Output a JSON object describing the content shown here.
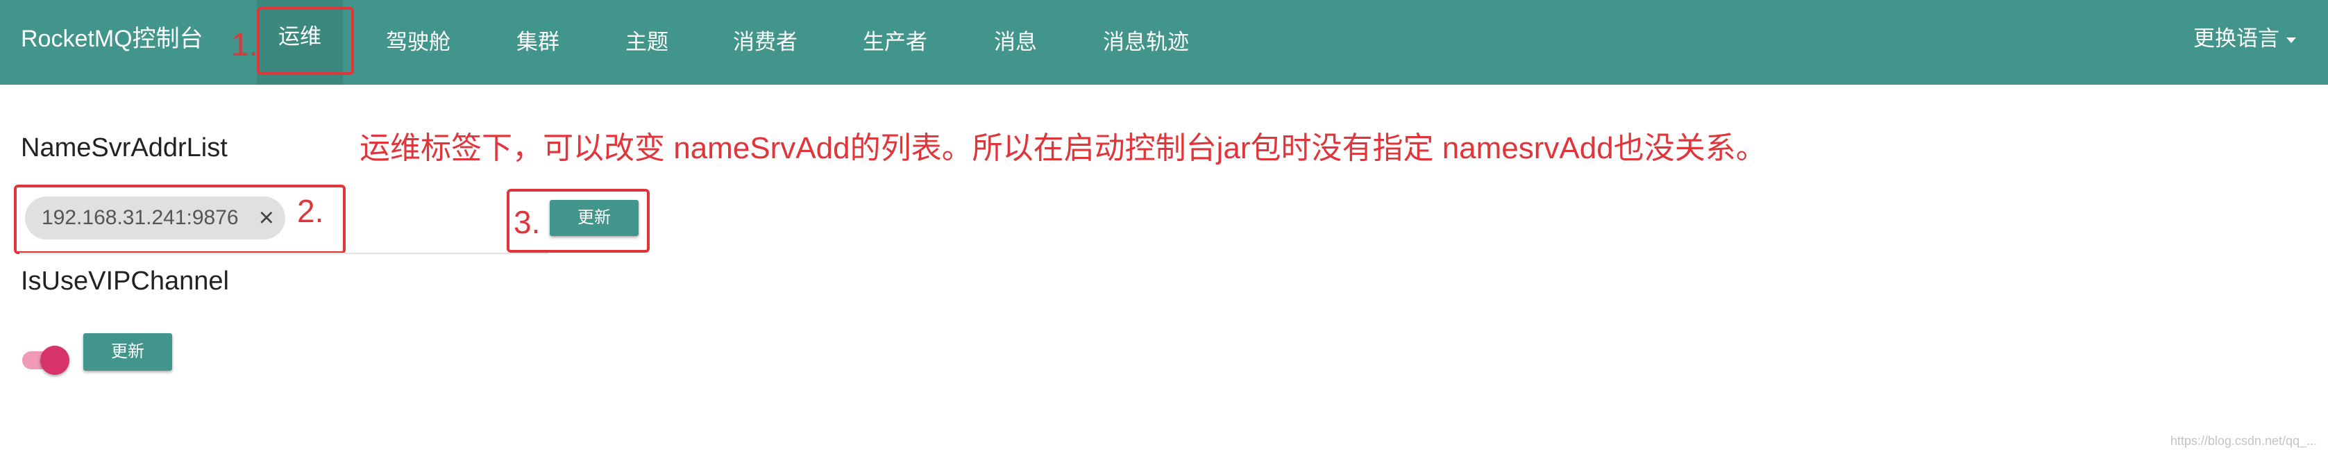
{
  "navbar": {
    "brand": "RocketMQ控制台",
    "items": [
      {
        "label": "运维"
      },
      {
        "label": "驾驶舱"
      },
      {
        "label": "集群"
      },
      {
        "label": "主题"
      },
      {
        "label": "消费者"
      },
      {
        "label": "生产者"
      },
      {
        "label": "消息"
      },
      {
        "label": "消息轨迹"
      }
    ],
    "language": "更换语言"
  },
  "ops": {
    "namesrv_label": "NameSvrAddrList",
    "namesrv_chip": "192.168.31.241:9876",
    "update_button": "更新",
    "vip_label": "IsUseVIPChannel",
    "vip_enabled": true,
    "vip_update_button": "更新"
  },
  "annotations": {
    "step1": "1.",
    "step2": "2.",
    "step3": "3.",
    "note": "运维标签下，可以改变 nameSrvAdd的列表。所以在启动控制台jar包时没有指定 namesrvAdd也没关系。"
  },
  "watermark": "https://blog.csdn.net/qq_..."
}
